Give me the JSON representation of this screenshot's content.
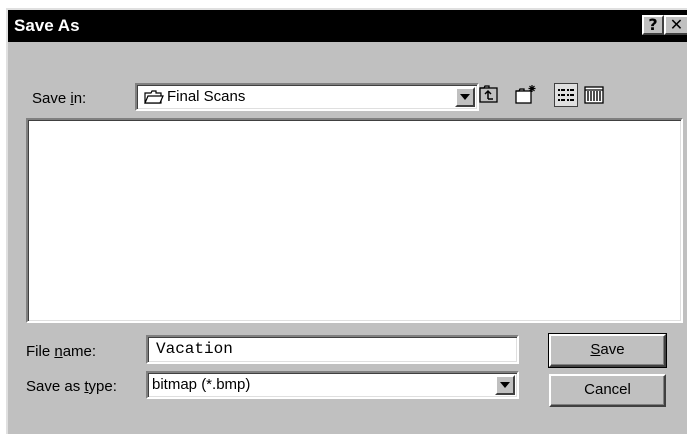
{
  "window": {
    "title": "Save As",
    "help_glyph": "?",
    "close_glyph": "✕"
  },
  "save_in": {
    "label_pre": "Save ",
    "label_key": "i",
    "label_post": "n:",
    "value": "Final Scans",
    "icon": "folder-icon"
  },
  "toolbar": {
    "up_icon": "up-one-level-icon",
    "new_folder_icon": "new-folder-icon",
    "list_icon": "list-view-icon",
    "details_icon": "details-view-icon"
  },
  "file_name": {
    "label_pre": "File ",
    "label_key": "n",
    "label_post": "ame:",
    "value": "Vacation"
  },
  "save_type": {
    "label_pre": "Save as ",
    "label_key": "t",
    "label_post": "ype:",
    "value": "bitmap (*.bmp)"
  },
  "buttons": {
    "save_key": "S",
    "save_rest": "ave",
    "cancel": "Cancel"
  }
}
